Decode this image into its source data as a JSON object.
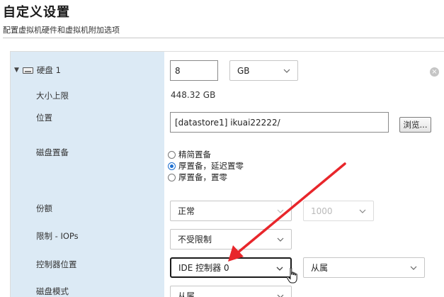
{
  "header": {
    "title": "自定义设置",
    "subtitle": "配置虚拟机硬件和虚拟机附加选项"
  },
  "disk": {
    "label": "硬盘 1",
    "size_value": "8",
    "size_unit": "GB",
    "clear_label": "×"
  },
  "max_size": {
    "label": "大小上限",
    "value": "448.32 GB"
  },
  "location": {
    "label": "位置",
    "value": "[datastore1] ikuai22222/",
    "browse_label": "浏览..."
  },
  "provisioning": {
    "label": "磁盘置备",
    "options": [
      {
        "label": "精简置备",
        "checked": false
      },
      {
        "label": "厚置备，延迟置零",
        "checked": true
      },
      {
        "label": "厚置备，置零",
        "checked": false
      }
    ]
  },
  "shares": {
    "label": "份额",
    "value": "正常",
    "amount": "1000"
  },
  "limit_iops": {
    "label": "限制 - IOPs",
    "value": "不受限制"
  },
  "controller": {
    "label": "控制器位置",
    "value": "IDE 控制器 0",
    "slot": "从属"
  },
  "disk_mode": {
    "label": "磁盘模式",
    "value": "从属"
  },
  "colors": {
    "label_bg": "#dceaf5",
    "annotation_arrow": "#e8262b",
    "radio_accent": "#1d6fd1"
  }
}
